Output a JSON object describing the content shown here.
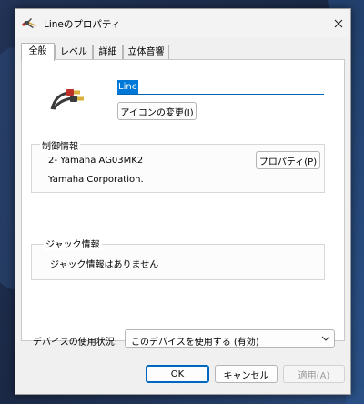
{
  "window": {
    "title": "Lineのプロパティ",
    "close_glyph": "✕"
  },
  "tabs": [
    {
      "label": "全般",
      "active": true
    },
    {
      "label": "レベル",
      "active": false
    },
    {
      "label": "詳細",
      "active": false
    },
    {
      "label": "立体音響",
      "active": false
    }
  ],
  "general": {
    "device_name": "Line",
    "change_icon_label": "アイコンの変更(I)"
  },
  "controller": {
    "title": "制御情報",
    "device_model": "2- Yamaha AG03MK2",
    "manufacturer": "Yamaha Corporation.",
    "properties_label": "プロパティ(P)"
  },
  "jack": {
    "title": "ジャック情報",
    "message": "ジャック情報はありません"
  },
  "usage": {
    "label": "デバイスの使用状況:",
    "selected": "このデバイスを使用する (有効)"
  },
  "buttons": {
    "ok": "OK",
    "cancel": "キャンセル",
    "apply": "適用(A)"
  },
  "colors": {
    "accent": "#0078d7",
    "cable_red": "#c0302a",
    "plug_gold": "#d8b13a"
  }
}
